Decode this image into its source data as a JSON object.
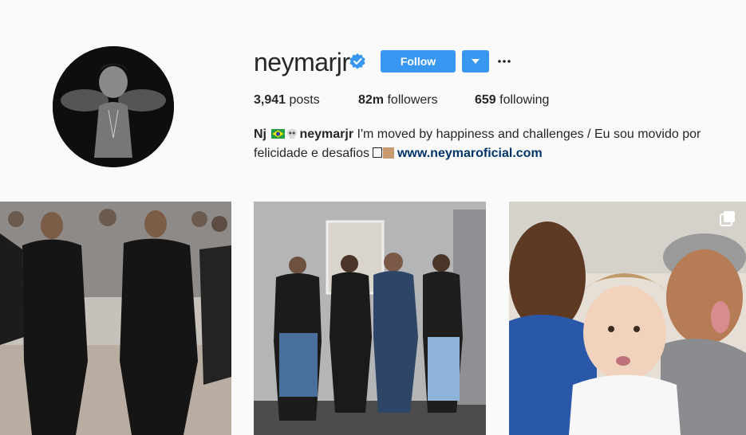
{
  "profile": {
    "username": "neymarjr",
    "follow_label": "Follow",
    "stats": {
      "posts_count": "3,941",
      "posts_label": "posts",
      "followers_count": "82m",
      "followers_label": "followers",
      "following_count": "659",
      "following_label": "following"
    },
    "bio": {
      "name": "Nj",
      "mention": "neymarjr",
      "text_line1": " I'm moved by happiness and challenges / Eu sou movido por",
      "text_line2": "felicidade e desafios",
      "link": "www.neymaroficial.com"
    }
  },
  "posts": [
    {
      "alt": "two men in black suits walking",
      "multi": false
    },
    {
      "alt": "four young men posing in a room",
      "multi": false
    },
    {
      "alt": "selfie with a baby and two men",
      "multi": true
    }
  ],
  "colors": {
    "accent": "#3897f0",
    "link": "#003569",
    "text": "#262626",
    "background": "#fafafa"
  }
}
